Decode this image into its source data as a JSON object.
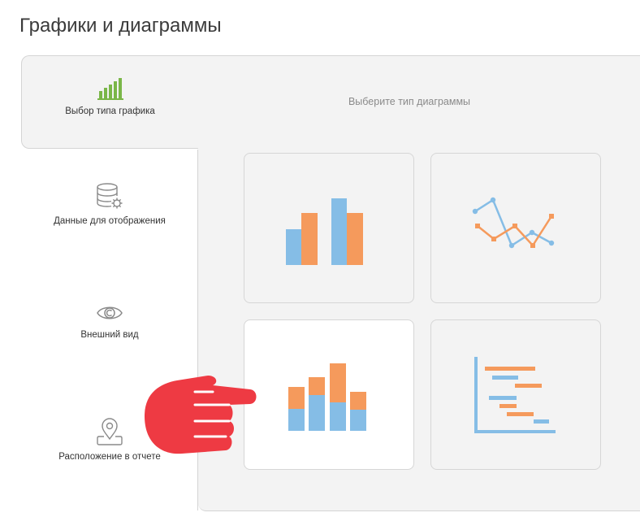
{
  "page": {
    "title": "Графики и диаграммы"
  },
  "steps": [
    {
      "label": "Выбор типа графика",
      "icon": "bar-chart-icon",
      "active": true
    },
    {
      "label": "Данные для отображения",
      "icon": "database-settings-icon",
      "active": false
    },
    {
      "label": "Внешний вид",
      "icon": "eye-icon",
      "active": false
    },
    {
      "label": "Расположение в отчете",
      "icon": "location-pin-icon",
      "active": false
    }
  ],
  "main": {
    "hint": "Выберите тип диаграммы",
    "chart_types": [
      {
        "name": "grouped-bar",
        "icon": "grouped-bar-chart-icon",
        "selected": false
      },
      {
        "name": "line",
        "icon": "line-chart-icon",
        "selected": false
      },
      {
        "name": "stacked-bar",
        "icon": "stacked-bar-chart-icon",
        "selected": true
      },
      {
        "name": "gantt",
        "icon": "gantt-chart-icon",
        "selected": false
      }
    ]
  },
  "colors": {
    "blue": "#85bde6",
    "orange": "#f59a5c",
    "green": "#7ab648",
    "pointer": "#ee3a43"
  }
}
